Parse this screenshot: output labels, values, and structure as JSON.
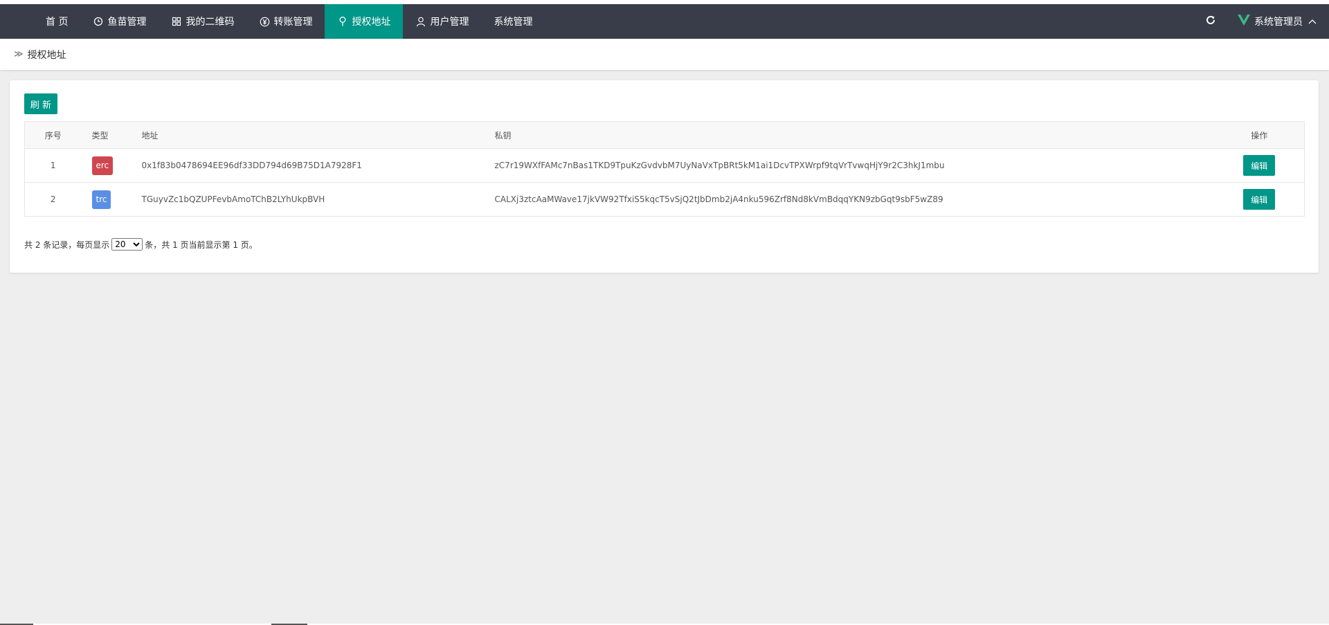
{
  "nav": {
    "items": [
      {
        "label": "首 页",
        "icon": ""
      },
      {
        "label": "鱼苗管理",
        "icon": "clock-icon"
      },
      {
        "label": "我的二维码",
        "icon": "grid-icon"
      },
      {
        "label": "转账管理",
        "icon": "yen-icon"
      },
      {
        "label": "授权地址",
        "icon": "pin-icon",
        "active": true
      },
      {
        "label": "用户管理",
        "icon": "user-icon"
      },
      {
        "label": "系统管理",
        "icon": ""
      }
    ],
    "user": "系统管理员",
    "accent": "#009688",
    "bg": "#393d49"
  },
  "breadcrumb": {
    "sep": "≫",
    "label": "授权地址"
  },
  "toolbar": {
    "refresh_label": "刷 新"
  },
  "table": {
    "headers": {
      "idx": "序号",
      "type": "类型",
      "addr": "地址",
      "key": "私钥",
      "op": "操作"
    },
    "rows": [
      {
        "idx": "1",
        "type": "erc",
        "type_color": "#d0464f",
        "addr": "0x1f83b0478694EE96df33DD794d69B75D1A7928F1",
        "key": "zC7r19WXfFAMc7nBas1TKD9TpuKzGvdvbM7UyNaVxTpBRt5kM1ai1DcvTPXWrpf9tqVrTvwqHjY9r2C3hkJ1mbu",
        "op": "编辑"
      },
      {
        "idx": "2",
        "type": "trc",
        "type_color": "#5b8fe6",
        "addr": "TGuyvZc1bQZUPFevbAmoTChB2LYhUkpBVH",
        "key": "CALXj3ztcAaMWave17jkVW92TfxiS5kqcT5vSjQ2tJbDmb2jA4nku596Zrf8Nd8kVmBdqqYKN9zbGqt9sbF5wZ89",
        "op": "编辑"
      }
    ]
  },
  "pager": {
    "prefix": "共 2 条记录，每页显示",
    "page_size": "20",
    "suffix": "条，共 1 页当前显示第 1 页。"
  }
}
